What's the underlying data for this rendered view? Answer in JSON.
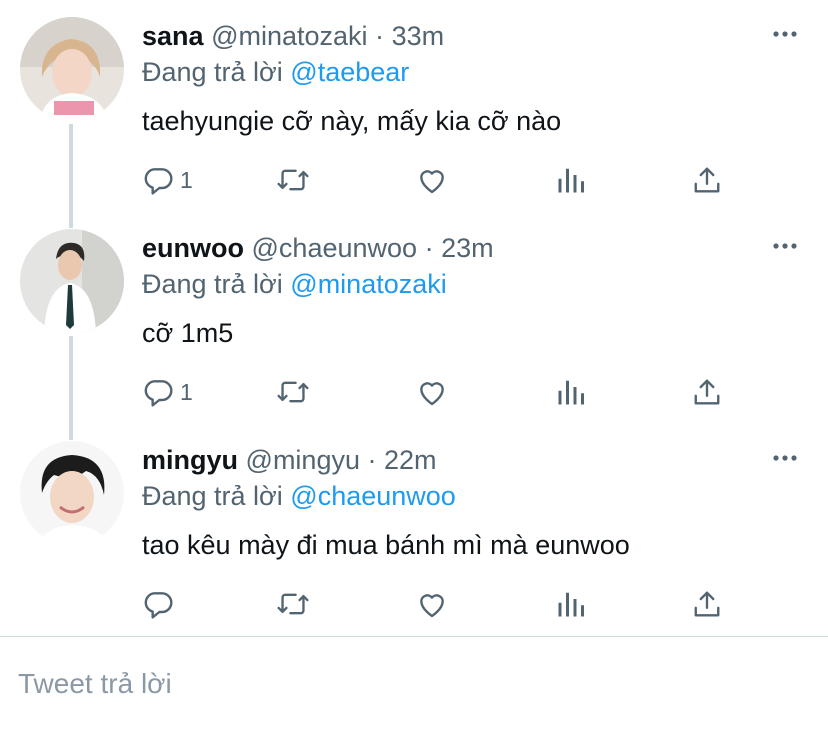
{
  "tweets": [
    {
      "name": "sana",
      "handle": "@minatozaki",
      "dot": "·",
      "time": "33m",
      "replying_prefix": "Đang trả lời",
      "replying_to": "@taebear",
      "text": "taehyungie cỡ này, mấy kia cỡ nào",
      "reply_count": "1",
      "avatar_desc": "user avatar"
    },
    {
      "name": "eunwoo",
      "handle": "@chaeunwoo",
      "dot": "·",
      "time": "23m",
      "replying_prefix": "Đang trả lời",
      "replying_to": "@minatozaki",
      "text": "cỡ 1m5",
      "reply_count": "1",
      "avatar_desc": "user avatar"
    },
    {
      "name": "mingyu",
      "handle": "@mingyu",
      "dot": "·",
      "time": "22m",
      "replying_prefix": "Đang trả lời",
      "replying_to": "@chaeunwoo",
      "text": "tao kêu mày đi mua bánh mì mà eunwoo",
      "reply_count": "",
      "avatar_desc": "user avatar"
    }
  ],
  "reply_placeholder": "Tweet trả lời",
  "icons": [
    "reply-icon",
    "retweet-icon",
    "like-icon",
    "analytics-icon",
    "share-icon",
    "more-icon"
  ],
  "colors": {
    "accent": "#1d9bf0",
    "secondary_text": "#536471",
    "thread_line": "#cfd9de"
  }
}
